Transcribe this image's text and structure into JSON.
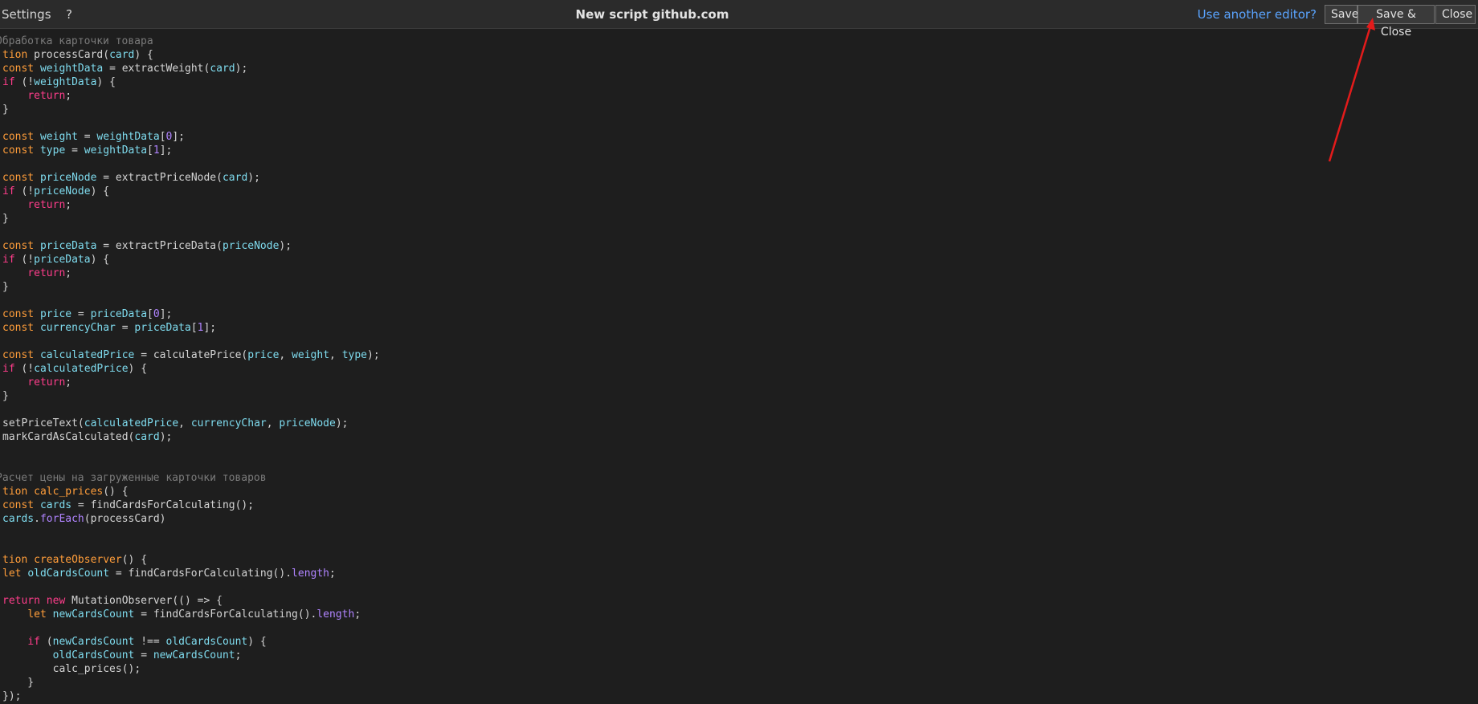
{
  "menu": {
    "settings": "Settings",
    "help": "?"
  },
  "title": "New script github.com",
  "toolbar": {
    "editor_link": "Use another editor?",
    "save": "Save",
    "save_close": "Save & Close",
    "close": "Close"
  },
  "colors": {
    "background": "#1e1e1e",
    "topbar": "#2b2b2b",
    "link": "#5aa4ff",
    "arrow": "#e31b1b"
  },
  "code_lines": [
    [
      [
        "c",
        "Обработка карточки товара"
      ]
    ],
    [
      [
        "k",
        "tion "
      ],
      [
        "p",
        "processCard("
      ],
      [
        "v",
        "card"
      ],
      [
        "p",
        ") {"
      ]
    ],
    [
      [
        "k",
        "const "
      ],
      [
        "v",
        "weightData"
      ],
      [
        "p",
        " = extractWeight("
      ],
      [
        "v",
        "card"
      ],
      [
        "p",
        ");"
      ]
    ],
    [
      [
        "r",
        "if"
      ],
      [
        "p",
        " (!"
      ],
      [
        "v",
        "weightData"
      ],
      [
        "p",
        ") {"
      ]
    ],
    [
      [
        "p",
        "    "
      ],
      [
        "r",
        "return"
      ],
      [
        "p",
        ";"
      ]
    ],
    [
      [
        "p",
        "}"
      ]
    ],
    [],
    [
      [
        "k",
        "const "
      ],
      [
        "v",
        "weight"
      ],
      [
        "p",
        " = "
      ],
      [
        "v",
        "weightData"
      ],
      [
        "p",
        "["
      ],
      [
        "n",
        "0"
      ],
      [
        "p",
        "];"
      ]
    ],
    [
      [
        "k",
        "const "
      ],
      [
        "v",
        "type"
      ],
      [
        "p",
        " = "
      ],
      [
        "v",
        "weightData"
      ],
      [
        "p",
        "["
      ],
      [
        "n",
        "1"
      ],
      [
        "p",
        "];"
      ]
    ],
    [],
    [
      [
        "k",
        "const "
      ],
      [
        "v",
        "priceNode"
      ],
      [
        "p",
        " = extractPriceNode("
      ],
      [
        "v",
        "card"
      ],
      [
        "p",
        ");"
      ]
    ],
    [
      [
        "r",
        "if"
      ],
      [
        "p",
        " (!"
      ],
      [
        "v",
        "priceNode"
      ],
      [
        "p",
        ") {"
      ]
    ],
    [
      [
        "p",
        "    "
      ],
      [
        "r",
        "return"
      ],
      [
        "p",
        ";"
      ]
    ],
    [
      [
        "p",
        "}"
      ]
    ],
    [],
    [
      [
        "k",
        "const "
      ],
      [
        "v",
        "priceData"
      ],
      [
        "p",
        " = extractPriceData("
      ],
      [
        "v",
        "priceNode"
      ],
      [
        "p",
        ");"
      ]
    ],
    [
      [
        "r",
        "if"
      ],
      [
        "p",
        " (!"
      ],
      [
        "v",
        "priceData"
      ],
      [
        "p",
        ") {"
      ]
    ],
    [
      [
        "p",
        "    "
      ],
      [
        "r",
        "return"
      ],
      [
        "p",
        ";"
      ]
    ],
    [
      [
        "p",
        "}"
      ]
    ],
    [],
    [
      [
        "k",
        "const "
      ],
      [
        "v",
        "price"
      ],
      [
        "p",
        " = "
      ],
      [
        "v",
        "priceData"
      ],
      [
        "p",
        "["
      ],
      [
        "n",
        "0"
      ],
      [
        "p",
        "];"
      ]
    ],
    [
      [
        "k",
        "const "
      ],
      [
        "v",
        "currencyChar"
      ],
      [
        "p",
        " = "
      ],
      [
        "v",
        "priceData"
      ],
      [
        "p",
        "["
      ],
      [
        "n",
        "1"
      ],
      [
        "p",
        "];"
      ]
    ],
    [],
    [
      [
        "k",
        "const "
      ],
      [
        "v",
        "calculatedPrice"
      ],
      [
        "p",
        " = calculatePrice("
      ],
      [
        "v",
        "price"
      ],
      [
        "p",
        ", "
      ],
      [
        "v",
        "weight"
      ],
      [
        "p",
        ", "
      ],
      [
        "v",
        "type"
      ],
      [
        "p",
        ");"
      ]
    ],
    [
      [
        "r",
        "if"
      ],
      [
        "p",
        " (!"
      ],
      [
        "v",
        "calculatedPrice"
      ],
      [
        "p",
        ") {"
      ]
    ],
    [
      [
        "p",
        "    "
      ],
      [
        "r",
        "return"
      ],
      [
        "p",
        ";"
      ]
    ],
    [
      [
        "p",
        "}"
      ]
    ],
    [],
    [
      [
        "p",
        "setPriceText("
      ],
      [
        "v",
        "calculatedPrice"
      ],
      [
        "p",
        ", "
      ],
      [
        "v",
        "currencyChar"
      ],
      [
        "p",
        ", "
      ],
      [
        "v",
        "priceNode"
      ],
      [
        "p",
        ");"
      ]
    ],
    [
      [
        "p",
        "markCardAsCalculated("
      ],
      [
        "v",
        "card"
      ],
      [
        "p",
        ");"
      ]
    ],
    [],
    [],
    [
      [
        "c",
        "Расчет цены на загруженные карточки товаров"
      ]
    ],
    [
      [
        "k",
        "tion "
      ],
      [
        "k",
        "calc_prices"
      ],
      [
        "p",
        "() {"
      ]
    ],
    [
      [
        "k",
        "const "
      ],
      [
        "v",
        "cards"
      ],
      [
        "p",
        " = findCardsForCalculating();"
      ]
    ],
    [
      [
        "v",
        "cards"
      ],
      [
        "p",
        "."
      ],
      [
        "n",
        "forEach"
      ],
      [
        "p",
        "(processCard)"
      ]
    ],
    [],
    [],
    [
      [
        "k",
        "tion "
      ],
      [
        "k",
        "createObserver"
      ],
      [
        "p",
        "() {"
      ]
    ],
    [
      [
        "k",
        "let "
      ],
      [
        "v",
        "oldCardsCount"
      ],
      [
        "p",
        " = findCardsForCalculating()."
      ],
      [
        "n",
        "length"
      ],
      [
        "p",
        ";"
      ]
    ],
    [],
    [
      [
        "r",
        "return new "
      ],
      [
        "p",
        "MutationObserver(() => {"
      ]
    ],
    [
      [
        "p",
        "    "
      ],
      [
        "k",
        "let "
      ],
      [
        "v",
        "newCardsCount"
      ],
      [
        "p",
        " = findCardsForCalculating()."
      ],
      [
        "n",
        "length"
      ],
      [
        "p",
        ";"
      ]
    ],
    [],
    [
      [
        "p",
        "    "
      ],
      [
        "r",
        "if"
      ],
      [
        "p",
        " ("
      ],
      [
        "v",
        "newCardsCount"
      ],
      [
        "p",
        " !== "
      ],
      [
        "v",
        "oldCardsCount"
      ],
      [
        "p",
        ") {"
      ]
    ],
    [
      [
        "p",
        "        "
      ],
      [
        "v",
        "oldCardsCount"
      ],
      [
        "p",
        " = "
      ],
      [
        "v",
        "newCardsCount"
      ],
      [
        "p",
        ";"
      ]
    ],
    [
      [
        "p",
        "        calc_prices();"
      ]
    ],
    [
      [
        "p",
        "    }"
      ]
    ],
    [
      [
        "p",
        "});"
      ]
    ]
  ]
}
